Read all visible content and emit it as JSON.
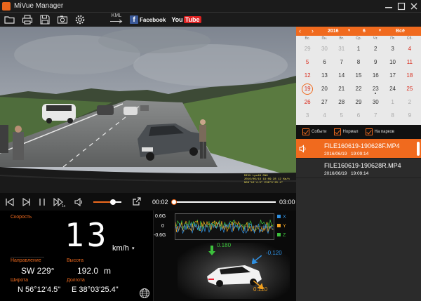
{
  "window": {
    "title": "MiVue Manager"
  },
  "toolbar": {
    "kml_label": "KML",
    "facebook_letter": "f",
    "facebook_label": "Facebook",
    "youtube_you": "You",
    "youtube_tube": "Tube"
  },
  "video": {
    "stamp_line1": "MIVU Lpu49 0N8",
    "stamp_line2": "2016/06/19 19:09:28 12 Km/h",
    "stamp_line3": "N56°12'4.5\" E38°3'25.4\""
  },
  "controls": {
    "speed_label": "1x",
    "time_current": "00:02",
    "time_total": "03:00",
    "volume": 0.7,
    "progress": 0.01
  },
  "info": {
    "speed_label": "Скорость",
    "speed_value": "13",
    "speed_unit": "km/h",
    "heading_label": "Направление",
    "heading_value": "SW 229°",
    "altitude_label": "Высота",
    "altitude_value": "192.0",
    "altitude_unit": "m",
    "lat_label": "Широта",
    "lat_value": "N 56°12'4.5\"",
    "lon_label": "Долгота",
    "lon_value": "E 38°03'25.4\""
  },
  "sensor": {
    "g_top": "0.6G",
    "g_mid": "0",
    "g_bot": "-0.6G",
    "axis_x": "X",
    "axis_y": "Y",
    "axis_z": "Z",
    "val_green": "0.180",
    "val_blue": "-0.120",
    "val_orange": "0.120",
    "colors": {
      "x": "#2f8fe0",
      "y": "#f0a020",
      "z": "#3cc03c"
    }
  },
  "calendar": {
    "prev": "‹",
    "next": "›",
    "year": "2016",
    "month": "6",
    "all": "Всё",
    "dows": [
      "Вс.",
      "Пн.",
      "Вт.",
      "Ср.",
      "Чт.",
      "Пт.",
      "Сб."
    ],
    "days": [
      {
        "d": "29",
        "t": "other"
      },
      {
        "d": "30",
        "t": "other"
      },
      {
        "d": "31",
        "t": "other"
      },
      {
        "d": "1",
        "t": ""
      },
      {
        "d": "2",
        "t": ""
      },
      {
        "d": "3",
        "t": ""
      },
      {
        "d": "4",
        "t": "red"
      },
      {
        "d": "5",
        "t": "red"
      },
      {
        "d": "6",
        "t": ""
      },
      {
        "d": "7",
        "t": ""
      },
      {
        "d": "8",
        "t": ""
      },
      {
        "d": "9",
        "t": ""
      },
      {
        "d": "10",
        "t": ""
      },
      {
        "d": "11",
        "t": "red"
      },
      {
        "d": "12",
        "t": "red"
      },
      {
        "d": "13",
        "t": ""
      },
      {
        "d": "14",
        "t": ""
      },
      {
        "d": "15",
        "t": ""
      },
      {
        "d": "16",
        "t": ""
      },
      {
        "d": "17",
        "t": ""
      },
      {
        "d": "18",
        "t": "red"
      },
      {
        "d": "19",
        "t": "today"
      },
      {
        "d": "20",
        "t": ""
      },
      {
        "d": "21",
        "t": ""
      },
      {
        "d": "22",
        "t": ""
      },
      {
        "d": "23",
        "t": ""
      },
      {
        "d": "24",
        "t": ""
      },
      {
        "d": "25",
        "t": "red"
      },
      {
        "d": "26",
        "t": "red"
      },
      {
        "d": "27",
        "t": ""
      },
      {
        "d": "28",
        "t": ""
      },
      {
        "d": "29",
        "t": ""
      },
      {
        "d": "30",
        "t": ""
      },
      {
        "d": "1",
        "t": "other"
      },
      {
        "d": "2",
        "t": "other"
      },
      {
        "d": "3",
        "t": "other"
      },
      {
        "d": "4",
        "t": "other"
      },
      {
        "d": "5",
        "t": "other"
      },
      {
        "d": "6",
        "t": "other"
      },
      {
        "d": "7",
        "t": "other"
      },
      {
        "d": "8",
        "t": "other"
      },
      {
        "d": "9",
        "t": "other"
      }
    ]
  },
  "filters": {
    "events": "Событи",
    "normal": "Нормал",
    "parking": "На парков"
  },
  "files": [
    {
      "name": "FILE160619-190628F.MP4",
      "date": "2016/06/19",
      "time": "19:09:14"
    },
    {
      "name": "FILE160619-190628R.MP4",
      "date": "2016/06/19",
      "time": "19:09:14"
    }
  ]
}
